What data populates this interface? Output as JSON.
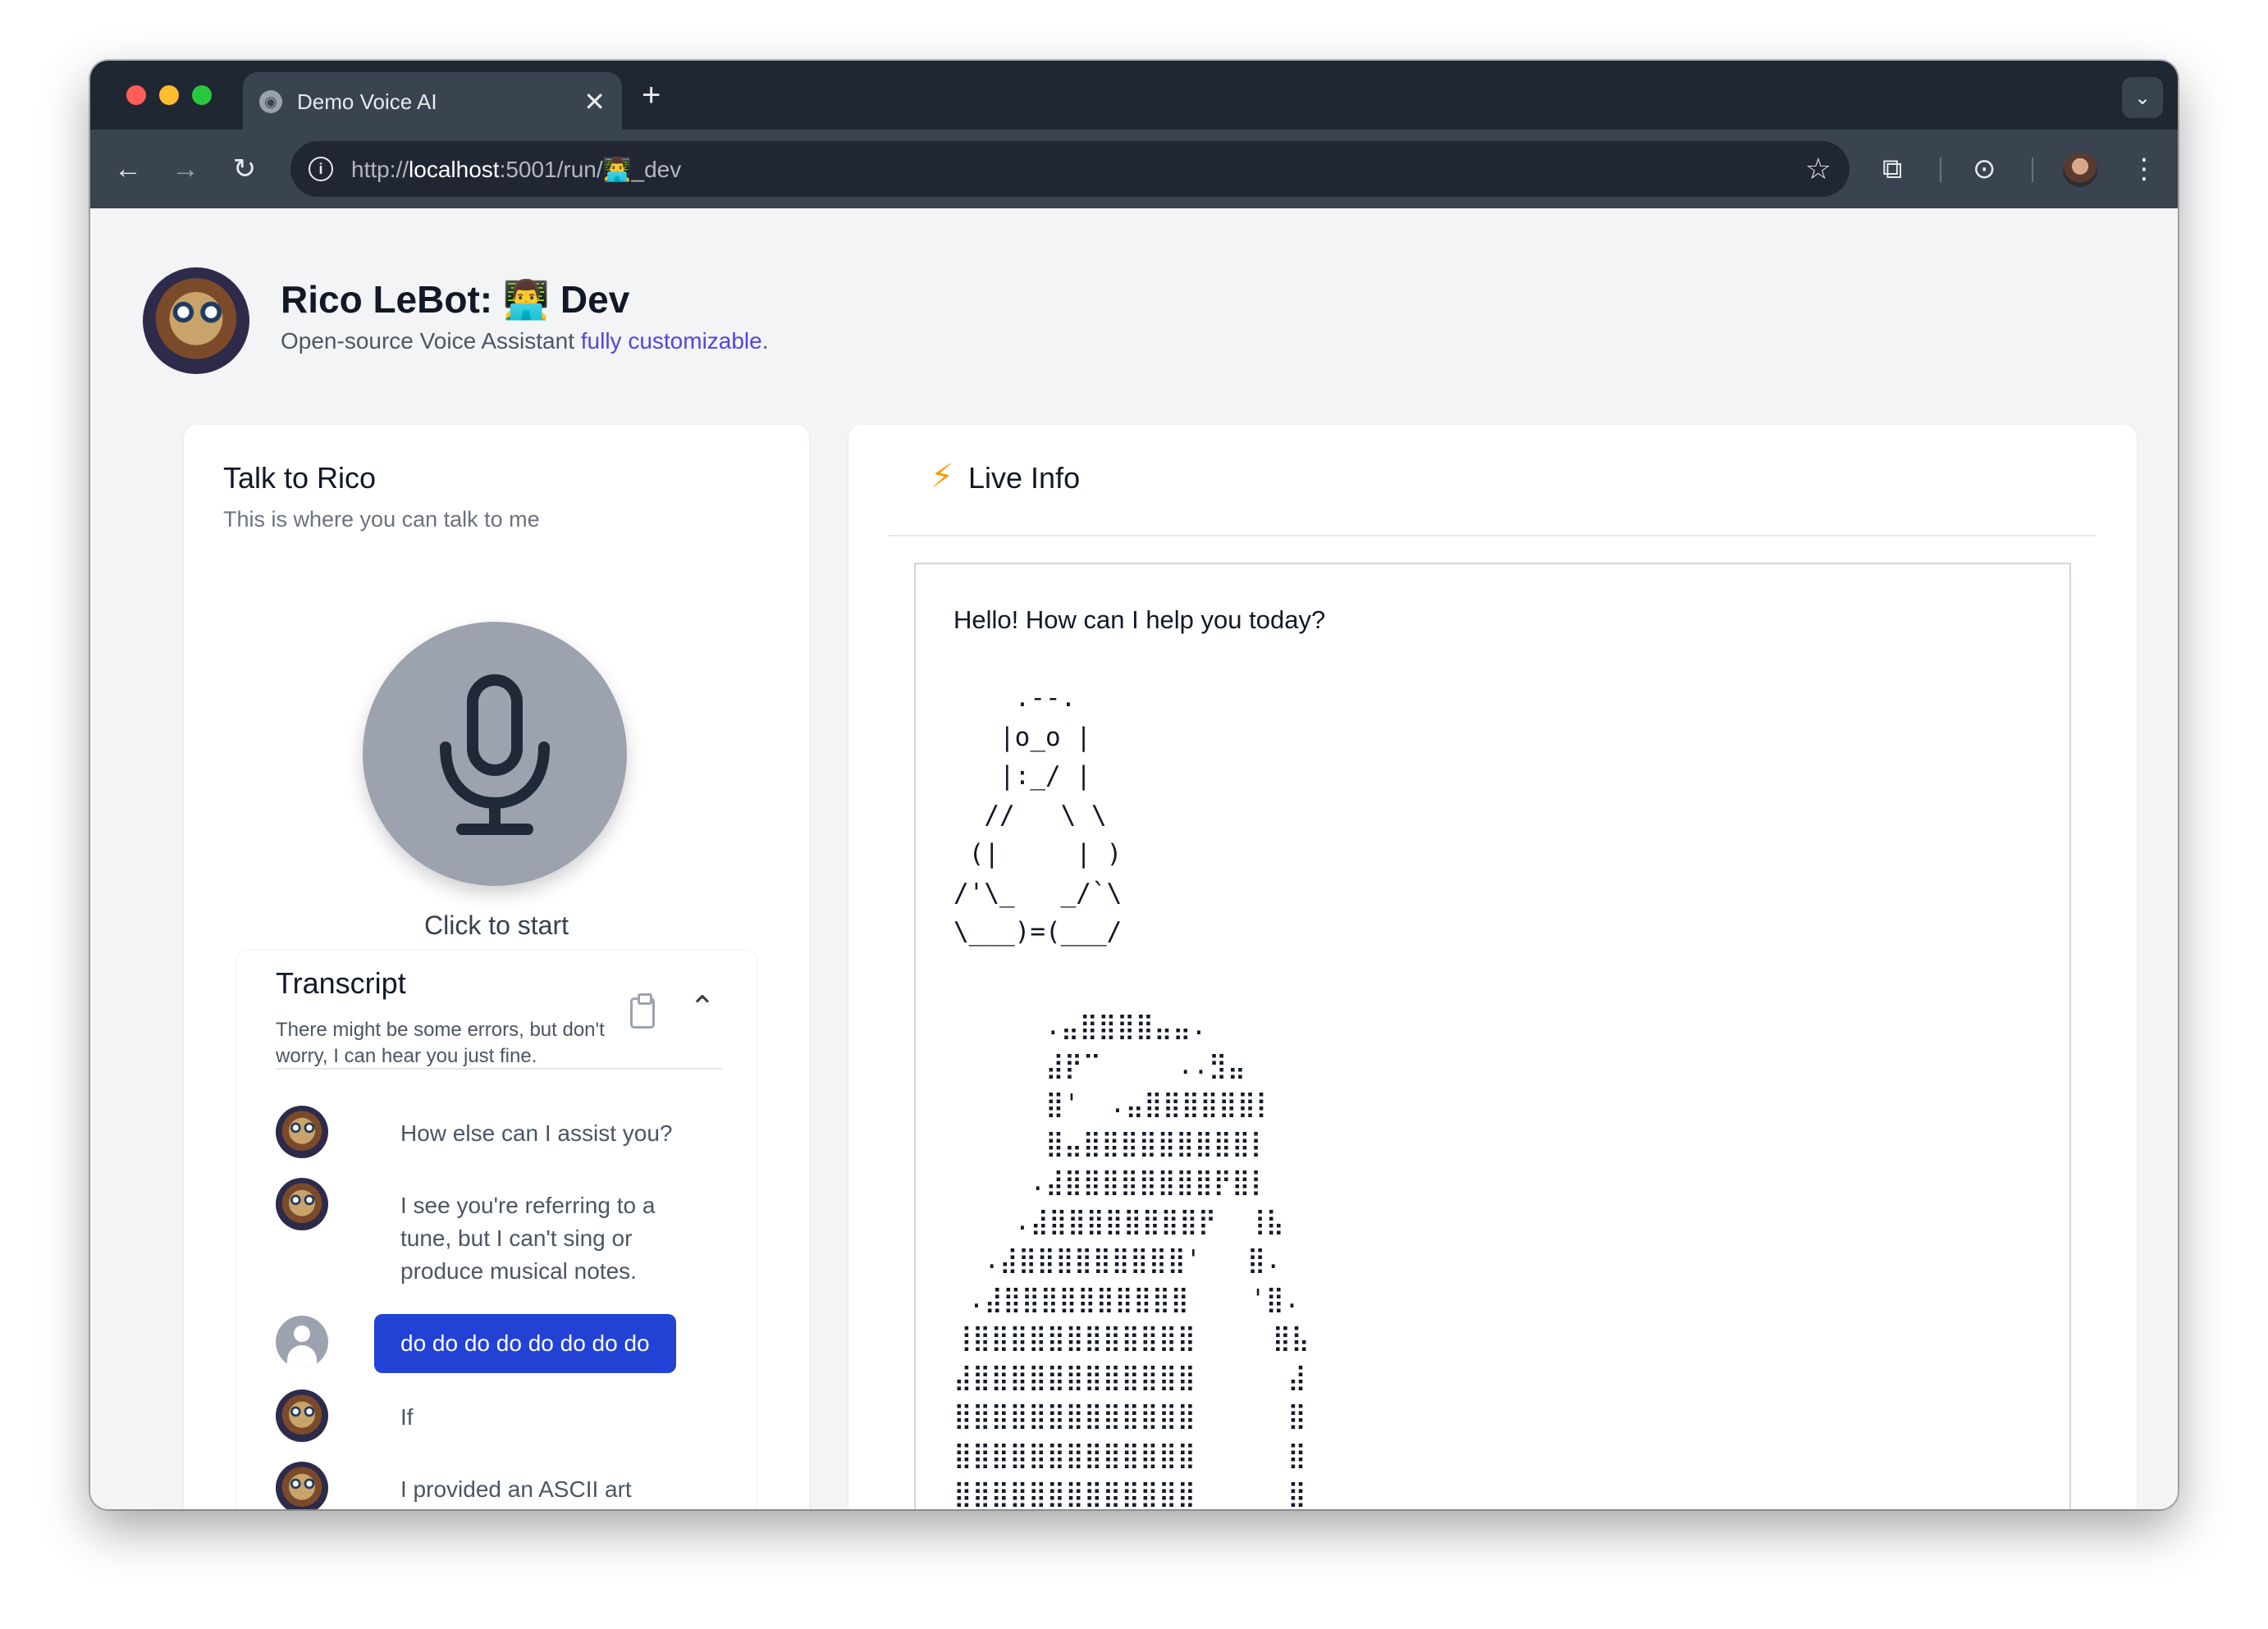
{
  "browser": {
    "tab_title": "Demo Voice AI",
    "tab_close": "✕",
    "new_tab": "+",
    "url_scheme": "http://",
    "url_host": "localhost",
    "url_rest": ":5001/run/👨‍💻_dev",
    "icons": {
      "back": "arrow-left-icon",
      "forward": "arrow-right-icon",
      "reload": "reload-icon",
      "site_info": "info-icon",
      "bookmark": "star-icon",
      "extensions": "puzzle-icon",
      "lens": "lens-icon",
      "menu": "kebab-menu-icon"
    }
  },
  "header": {
    "title": "Rico LeBot: 👨‍💻 Dev",
    "subtitle_prefix": "Open-source Voice Assistant ",
    "subtitle_link": "fully customizable",
    "subtitle_suffix": "."
  },
  "talk": {
    "title": "Talk to Rico",
    "subtitle": "This is where you can talk to me",
    "mic_label": "Click to start"
  },
  "transcript": {
    "title": "Transcript",
    "description": "There might be some errors, but don't worry, I can hear you just fine.",
    "messages": [
      {
        "role": "assistant",
        "text": "How else can I assist you?"
      },
      {
        "role": "assistant",
        "text": "I see you're referring to a tune, but I can't sing or produce musical notes."
      },
      {
        "role": "user",
        "text": "do do do do do do do do"
      },
      {
        "role": "assistant",
        "text": "If"
      },
      {
        "role": "assistant",
        "text": "I provided an ASCII art"
      }
    ]
  },
  "live": {
    "title": "Live Info",
    "greeting": "Hello! How can I help you today?",
    "ascii_art": "    .--.\n   |o_o |\n   |:_/ |\n  //   \\ \\\n (|     | )\n/'\\_   _/`\\\n\\___)=(___/",
    "braille_art": "      .⣤⣿⣿⣿⣿⣤⣤.\n      ⣼⡟⠉     ..⣻⣤\n      ⣿'  .⣤⣿⣿⣿⣿⣿⣿⡇\n      ⣿⣤⣿⣿⣿⣿⣿⣿⣿⣿⣿⡇\n     .⣼⣿⣿⣿⣿⣿⣿⣿⣿⡟⣿⡇\n    .⣼⣿⣿⣿⣿⣿⣿⣿⣿⡟  ⢸⣧\n  .⣼⣿⣿⣿⣿⣿⣿⣿⣿⣿'   ⣿.\n .⣼⣿⣿⣿⣿⣿⣿⣿⣿⣿⣿    '⣿.\n⢸⣿⣿⣿⣿⣿⣿⣿⣿⣿⣿⣿⣿     ⣿⣧\n⣼⣿⣿⣿⣿⣿⣿⣿⣿⣿⣿⣿⣿      ⣼\n⣿⣿⣿⣿⣿⣿⣿⣿⣿⣿⣿⣿⣿      ⣿\n⣿⣿⣿⣿⣿⣿⣿⣿⣿⣿⣿⣿⣿      ⣿\n⣿⣿⣿⣿⣿⣿⣿⣿⣿⣿⣿⣿⣿      ⣿"
  },
  "colors": {
    "accent": "#2242d6",
    "link": "#4f46e5",
    "mic_button": "#9ca3af",
    "page_bg": "#f3f4f6"
  }
}
